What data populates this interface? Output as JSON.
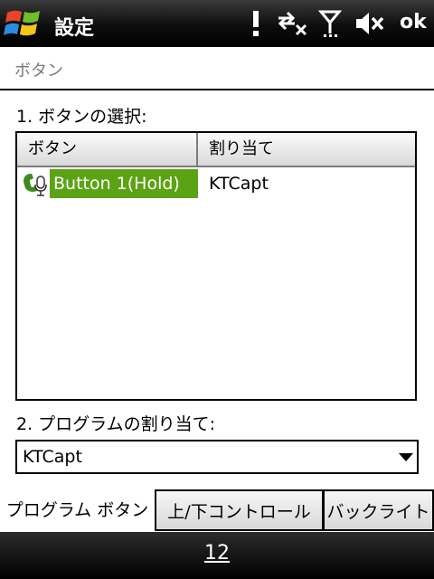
{
  "titlebar": {
    "title": "設定",
    "ok_label": "ok",
    "icons": [
      "windows-start-icon",
      "notification-icon",
      "data-connection-icon",
      "signal-icon",
      "volume-muted-icon"
    ]
  },
  "page": {
    "header": "ボタン"
  },
  "section1": {
    "label": "1. ボタンの選択:"
  },
  "list": {
    "columns": [
      "ボタン",
      "割り当て"
    ],
    "rows": [
      {
        "name": "Button 1(Hold)",
        "assignment": "KTCapt",
        "icon": "phone-mic-icon",
        "selected": true
      }
    ]
  },
  "section2": {
    "label": "2. プログラムの割り当て:"
  },
  "program_select": {
    "value": "KTCapt"
  },
  "tabs": [
    {
      "label": "プログラム ボタン",
      "active": true
    },
    {
      "label": "上/下コントロール",
      "active": false
    },
    {
      "label": "バックライト",
      "active": false
    }
  ],
  "softkey": {
    "label": "12"
  },
  "colors": {
    "selection": "#5ba314",
    "bar": "#000000"
  }
}
